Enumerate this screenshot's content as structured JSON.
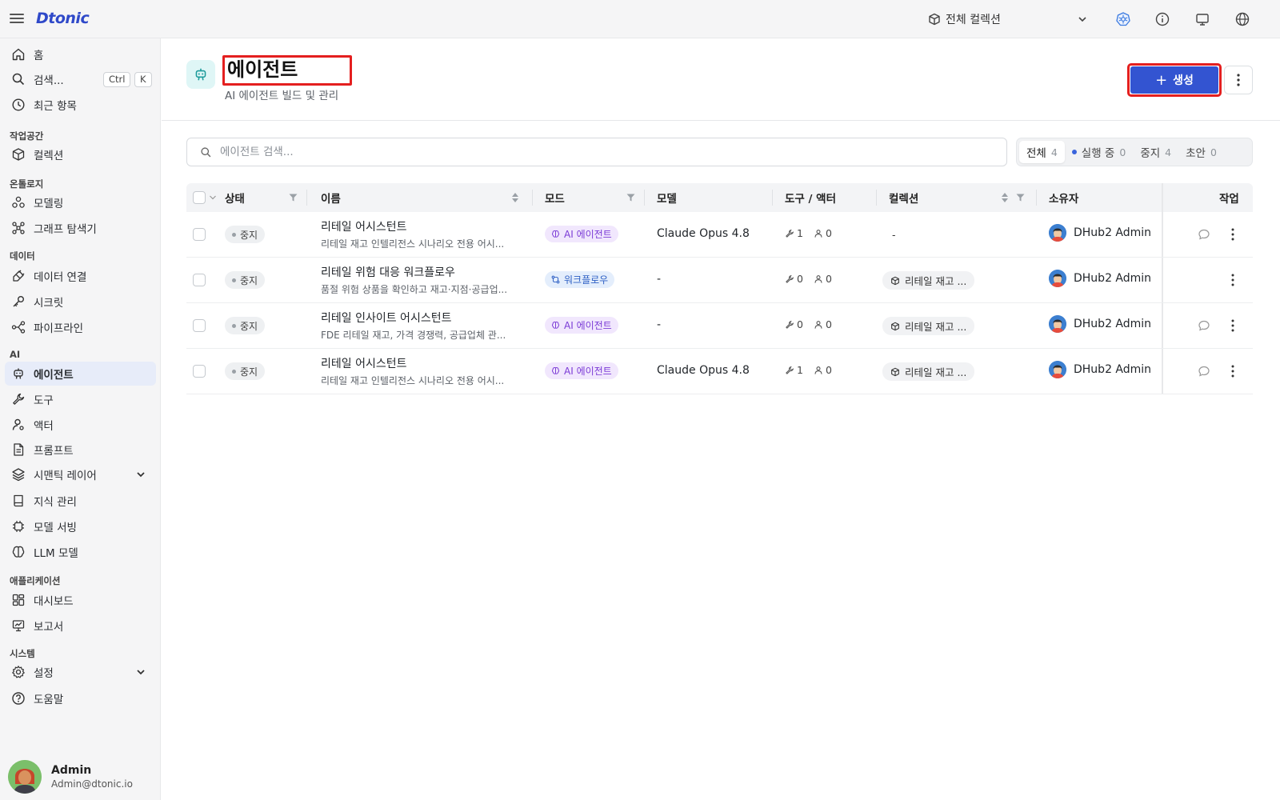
{
  "topbar": {
    "logo": "Dtonic",
    "collection_label": "전체 컬렉션"
  },
  "sidebar": {
    "search_label": "검색...",
    "kbd_ctrl": "Ctrl",
    "kbd_k": "K",
    "home": "홈",
    "recent": "최근 항목",
    "sections": {
      "workspace": "작업공간",
      "ontology": "온톨로지",
      "data": "데이터",
      "ai": "AI",
      "apps": "애플리케이션",
      "system": "시스템"
    },
    "items": {
      "collections": "컬렉션",
      "modeling": "모델링",
      "graph_explorer": "그래프 탐색기",
      "data_connection": "데이터 연결",
      "secrets": "시크릿",
      "pipeline": "파이프라인",
      "agents": "에이전트",
      "tools": "도구",
      "actors": "액터",
      "prompts": "프롬프트",
      "semantic_layer": "시맨틱 레이어",
      "knowledge": "지식 관리",
      "model_serving": "모델 서빙",
      "llm_models": "LLM 모델",
      "dashboards": "대시보드",
      "reports": "보고서",
      "settings": "설정",
      "help": "도움말"
    },
    "user": {
      "name": "Admin",
      "email": "Admin@dtonic.io"
    }
  },
  "header": {
    "title": "에이전트",
    "subtitle": "AI 에이전트 빌드 및 관리",
    "create_label": "생성",
    "create_plus": "+"
  },
  "search": {
    "placeholder": "에이전트 검색..."
  },
  "filters": [
    {
      "label": "전체",
      "count": "4"
    },
    {
      "label": "실행 중",
      "count": "0"
    },
    {
      "label": "중지",
      "count": "4"
    },
    {
      "label": "초안",
      "count": "0"
    }
  ],
  "table": {
    "columns": {
      "status": "상태",
      "name": "이름",
      "mode": "모드",
      "model": "모델",
      "tools": "도구 / 액터",
      "collection": "컬렉션",
      "owner": "소유자",
      "actions": "작업"
    },
    "rows": [
      {
        "status": "중지",
        "name": "리테일 어시스턴트",
        "desc": "리테일 재고 인텔리전스 시나리오 전용 어시...",
        "mode": "AI 에이전트",
        "model": "Claude Opus 4.8",
        "tools": "1",
        "actors": "0",
        "collection": "-",
        "owner": "DHub2 Admin"
      },
      {
        "status": "중지",
        "name": "리테일 위험 대응 워크플로우",
        "desc": "품절 위험 상품을 확인하고 재고·지점·공급업...",
        "mode": "워크플로우",
        "model": "-",
        "tools": "0",
        "actors": "0",
        "collection": "리테일 재고 ...",
        "owner": "DHub2 Admin"
      },
      {
        "status": "중지",
        "name": "리테일 인사이트 어시스턴트",
        "desc": "FDE 리테일 재고, 가격 경쟁력, 공급업체 관...",
        "mode": "AI 에이전트",
        "model": "-",
        "tools": "0",
        "actors": "0",
        "collection": "리테일 재고 ...",
        "owner": "DHub2 Admin"
      },
      {
        "status": "중지",
        "name": "리테일 어시스턴트",
        "desc": "리테일 재고 인텔리전스 시나리오 전용 어시...",
        "mode": "AI 에이전트",
        "model": "Claude Opus 4.8",
        "tools": "1",
        "actors": "0",
        "collection": "리테일 재고 ...",
        "owner": "DHub2 Admin"
      }
    ]
  },
  "colors": {
    "accent": "#3354d1",
    "highlight_box": "#e41f1f",
    "ai_badge_text": "#7b3bd6",
    "workflow_badge_text": "#2d5fc4"
  }
}
